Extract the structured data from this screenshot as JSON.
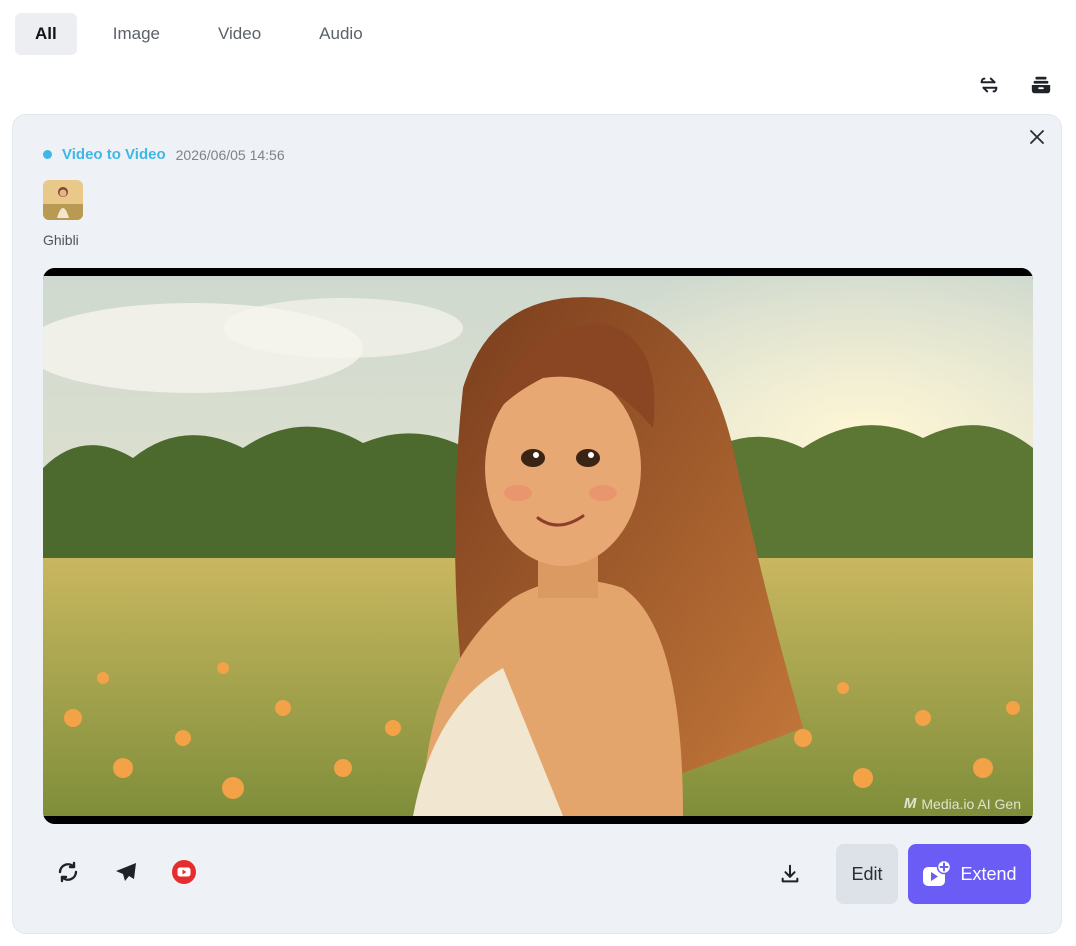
{
  "tabs": [
    {
      "label": "All",
      "active": true
    },
    {
      "label": "Image",
      "active": false
    },
    {
      "label": "Video",
      "active": false
    },
    {
      "label": "Audio",
      "active": false
    }
  ],
  "top_icons": [
    "swap-icon",
    "stack-icon"
  ],
  "card": {
    "type_label": "Video to Video",
    "type_color": "#3fb7e6",
    "timestamp": "2026/06/05 14:56",
    "style_label": "Ghibli",
    "watermark": "Media.io AI Gen",
    "watermark_logo": "M"
  },
  "actions": {
    "left_icons": [
      "regenerate-icon",
      "send-icon",
      "youtube-icon"
    ],
    "edit_label": "Edit",
    "extend_label": "Extend",
    "accent": "#6b5cf6"
  }
}
